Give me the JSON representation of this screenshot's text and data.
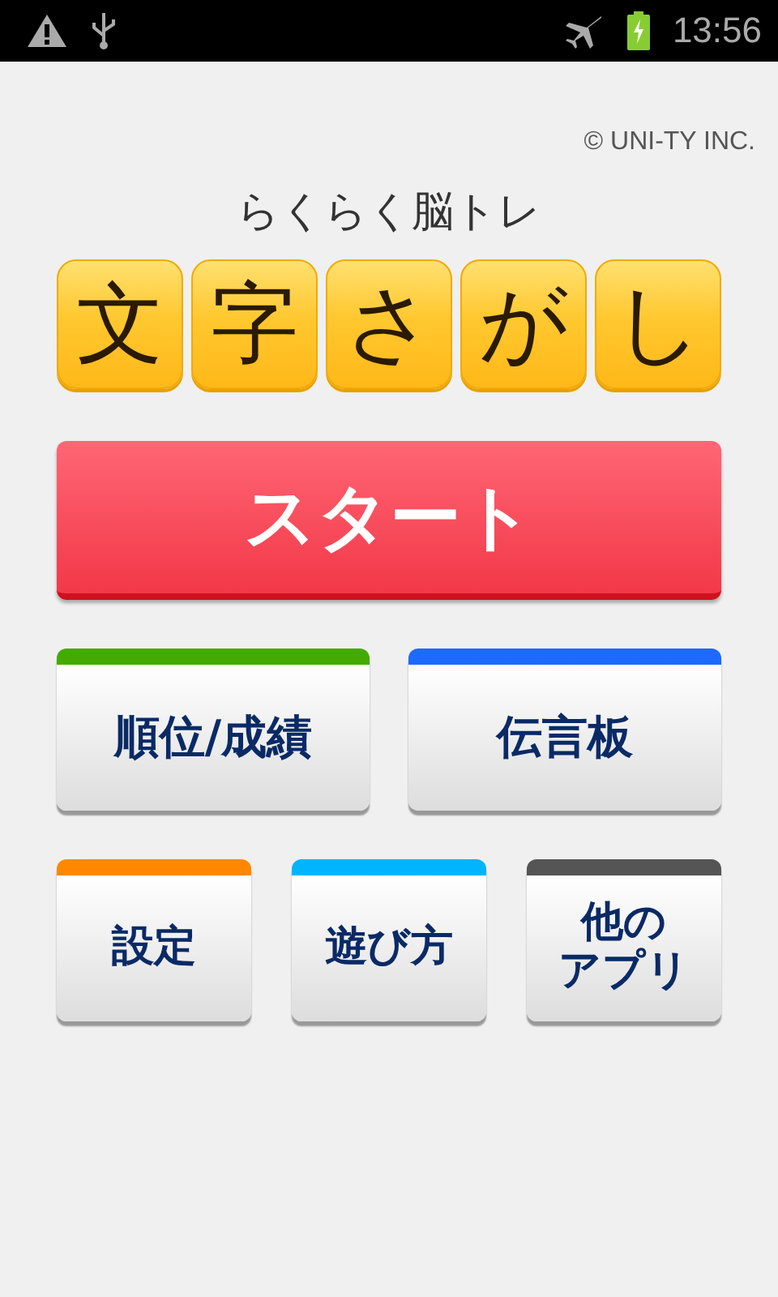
{
  "status_bar": {
    "time": "13:56"
  },
  "copyright": "© UNI-TY INC.",
  "subtitle": "らくらく脳トレ",
  "title_tiles": [
    "文",
    "字",
    "さ",
    "が",
    "し"
  ],
  "start_button": "スタート",
  "menu_rows": [
    [
      {
        "label": "順位/成績",
        "color": "#44aa00"
      },
      {
        "label": "伝言板",
        "color": "#1e6aff"
      }
    ],
    [
      {
        "label": "設定",
        "color": "#ff8800"
      },
      {
        "label": "遊び方",
        "color": "#00b4ff"
      },
      {
        "lines": [
          "他の",
          "アプリ"
        ],
        "color": "#555555"
      }
    ]
  ]
}
